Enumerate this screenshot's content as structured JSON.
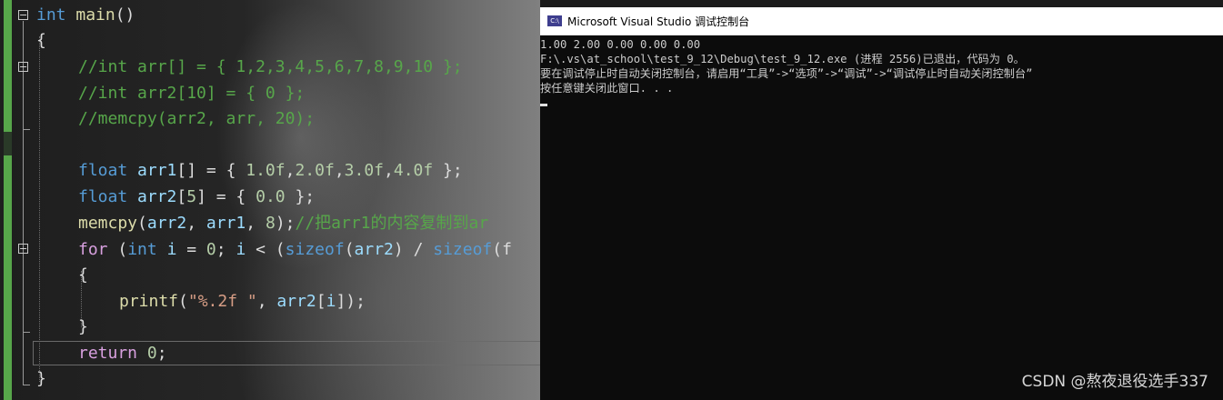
{
  "editor": {
    "lines": {
      "l1": [
        "int",
        "main",
        "()"
      ],
      "l2": [
        "{"
      ],
      "l3": [
        "//int arr[] = { 1,2,3,4,5,6,7,8,9,10 };"
      ],
      "l4": [
        "//int arr2[10] = { 0 };"
      ],
      "l5": [
        "//memcpy(arr2, arr, 20);"
      ],
      "l7": [
        "float",
        "arr1",
        "[] = { ",
        "1.0f",
        ",",
        "2.0f",
        ",",
        "3.0f",
        ",",
        "4.0f",
        " };"
      ],
      "l8": [
        "float",
        "arr2",
        "[",
        "5",
        "] = { ",
        "0.0",
        " };"
      ],
      "l9": [
        "memcpy",
        "(",
        "arr2",
        ", ",
        "arr1",
        ", ",
        "8",
        ");",
        "//把arr1的内容复制到ar"
      ],
      "l10": [
        "for",
        " (",
        "int",
        " ",
        "i",
        " = ",
        "0",
        "; ",
        "i",
        " < (",
        "sizeof",
        "(",
        "arr2",
        ") / ",
        "sizeof",
        "(f"
      ],
      "l11": [
        "{"
      ],
      "l12": [
        "printf",
        "(",
        "\"%.2f \"",
        ", ",
        "arr2",
        "[",
        "i",
        "]);"
      ],
      "l13": [
        "}"
      ],
      "l14": [
        "return",
        " ",
        "0",
        ";"
      ],
      "l15": [
        "}"
      ]
    },
    "fold_markers": [
      "−",
      "−",
      "−"
    ]
  },
  "console": {
    "title": "Microsoft Visual Studio 调试控制台",
    "icon_label": "C:\\",
    "lines": [
      "1.00 2.00 0.00 0.00 0.00",
      "F:\\.vs\\at_school\\test_9_12\\Debug\\test_9_12.exe (进程 2556)已退出，代码为 0。",
      "要在调试停止时自动关闭控制台，请启用“工具”->“选项”->“调试”->“调试停止时自动关闭控制台”",
      "按任意键关闭此窗口. . ."
    ]
  },
  "watermark": "CSDN @熬夜退役选手337",
  "colors": {
    "keyword": "#569cd6",
    "function": "#dcdcaa",
    "variable": "#9cdcfe",
    "number": "#b5cea8",
    "string": "#d69d85",
    "comment": "#57a64a",
    "control": "#d8a0df"
  }
}
